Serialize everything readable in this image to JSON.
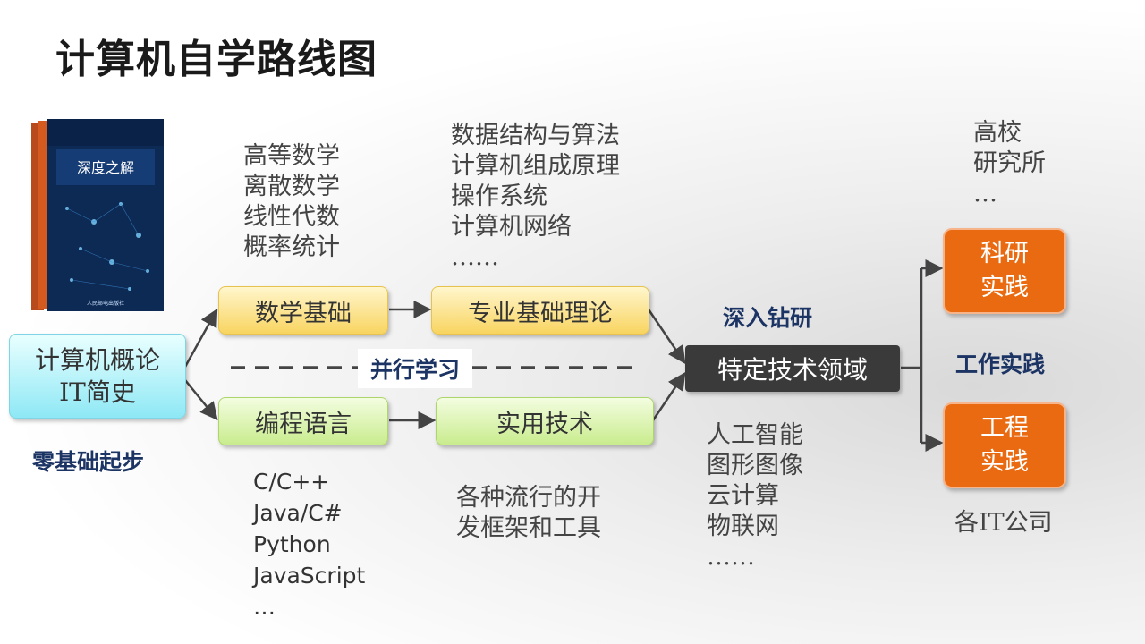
{
  "title": "计算机自学路线图",
  "start": {
    "box": "计算机概论\nIT简史",
    "label": "零基础起步"
  },
  "math": {
    "topics": "高等数学\n离散数学\n线性代数\n概率统计",
    "box": "数学基础"
  },
  "theory": {
    "topics": "数据结构与算法\n计算机组成原理\n操作系统\n计算机网络\n……",
    "box": "专业基础理论"
  },
  "parallel_label": "并行学习",
  "programming": {
    "box": "编程语言",
    "topics": "C/C++\nJava/C#\nPython\nJavaScript\n…"
  },
  "practical": {
    "box": "实用技术",
    "topics": "各种流行的开\n发框架和工具"
  },
  "deep_label": "深入钻研",
  "specific": {
    "box": "特定技术领域",
    "topics": "人工智能\n图形图像\n云计算\n物联网\n……"
  },
  "work_label": "工作实践",
  "research": {
    "box": "科研\n实践",
    "places": "高校\n研究所\n…"
  },
  "engineering": {
    "box": "工程\n实践",
    "places": "各IT公司"
  },
  "book": {
    "title": "深度之解",
    "publisher": "人民邮电出版社"
  },
  "colors": {
    "orange": "#e96a10",
    "dark_box": "#3a3a3a",
    "yellow": "#f8d460",
    "green": "#c9ec8e",
    "cyan": "#8ee8f5",
    "label_blue": "#1c3464"
  }
}
